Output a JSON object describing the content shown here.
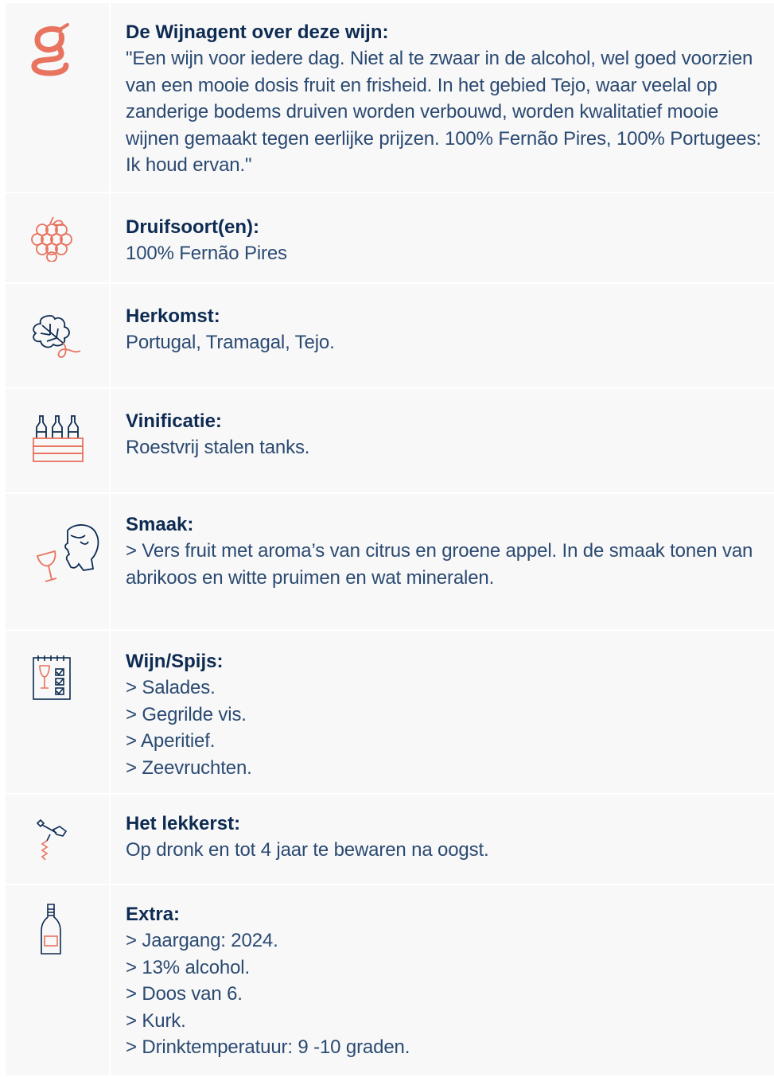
{
  "colors": {
    "navy": "#0d2b52",
    "text": "#2b4a72",
    "coral": "#e8735f",
    "panel": "#f8f8f8"
  },
  "rows": [
    {
      "icon": "wijnagent-logo-icon",
      "label": "De Wijnagent over deze wijn:",
      "lines": [
        "\"Een wijn voor iedere dag. Niet al te zwaar in de alcohol, wel goed voorzien",
        "van een mooie dosis fruit en frisheid. In het gebied Tejo, waar veelal op",
        "zanderige bodems druiven worden verbouwd, worden kwalitatief mooie",
        "wijnen gemaakt tegen eerlijke prijzen. 100% Fernão Pires, 100% Portugees:",
        "Ik houd ervan.\""
      ]
    },
    {
      "icon": "grapes-icon",
      "label": "Druifsoort(en):",
      "lines": [
        "100% Fernão Pires"
      ]
    },
    {
      "icon": "vine-leaf-icon",
      "label": "Herkomst:",
      "lines": [
        "Portugal, Tramagal, Tejo."
      ]
    },
    {
      "icon": "wine-crate-icon",
      "label": "Vinificatie:",
      "lines": [
        "Roestvrij stalen tanks."
      ]
    },
    {
      "icon": "tasting-head-icon",
      "label": "Smaak:",
      "lines": [
        "> Vers fruit met aroma’s van citrus en groene appel. In de smaak tonen van",
        "abrikoos en witte pruimen en wat mineralen."
      ]
    },
    {
      "icon": "menu-card-icon",
      "label": "Wijn/Spijs:",
      "lines": [
        "> Salades.",
        "> Gegrilde vis.",
        "> Aperitief.",
        "> Zeevruchten."
      ]
    },
    {
      "icon": "corkscrew-icon",
      "label": "Het lekkerst:",
      "lines": [
        "Op dronk en tot 4 jaar te bewaren na oogst."
      ]
    },
    {
      "icon": "wine-bottle-icon",
      "label": "Extra:",
      "lines": [
        "> Jaargang: 2024.",
        "> 13% alcohol.",
        "> Doos van 6.",
        "> Kurk.",
        "> Drinktemperatuur: 9 -10 graden."
      ]
    }
  ]
}
